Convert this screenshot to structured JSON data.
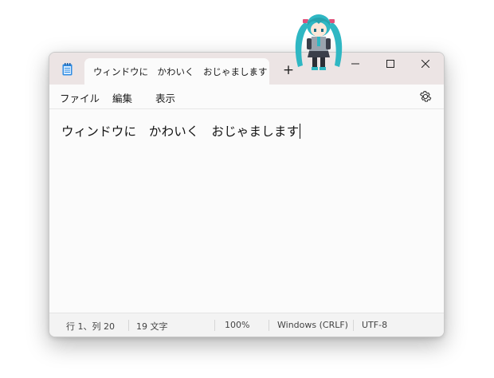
{
  "tab": {
    "title": "ウィンドウに　かわいく　おじゃまします"
  },
  "new_tab_label": "+",
  "menu": {
    "file": "ファイル",
    "edit": "編集",
    "view": "表示"
  },
  "editor": {
    "text": "ウィンドウに　かわいく　おじゃまします"
  },
  "status": {
    "position": "行 1、列 20",
    "char_count": "19 文字",
    "zoom": "100%",
    "line_ending": "Windows (CRLF)",
    "encoding": "UTF-8"
  },
  "icons": {
    "app": "notepad-icon",
    "minimize": "minimize-icon",
    "maximize": "maximize-icon",
    "close": "close-icon",
    "settings": "gear-icon",
    "mascot": "mascot-character-icon"
  },
  "colors": {
    "titlebar": "#ece4e4",
    "editor_bg": "#fbfbfb",
    "statusbar": "#f3f3f3",
    "mascot_hair": "#2fb7c3"
  }
}
